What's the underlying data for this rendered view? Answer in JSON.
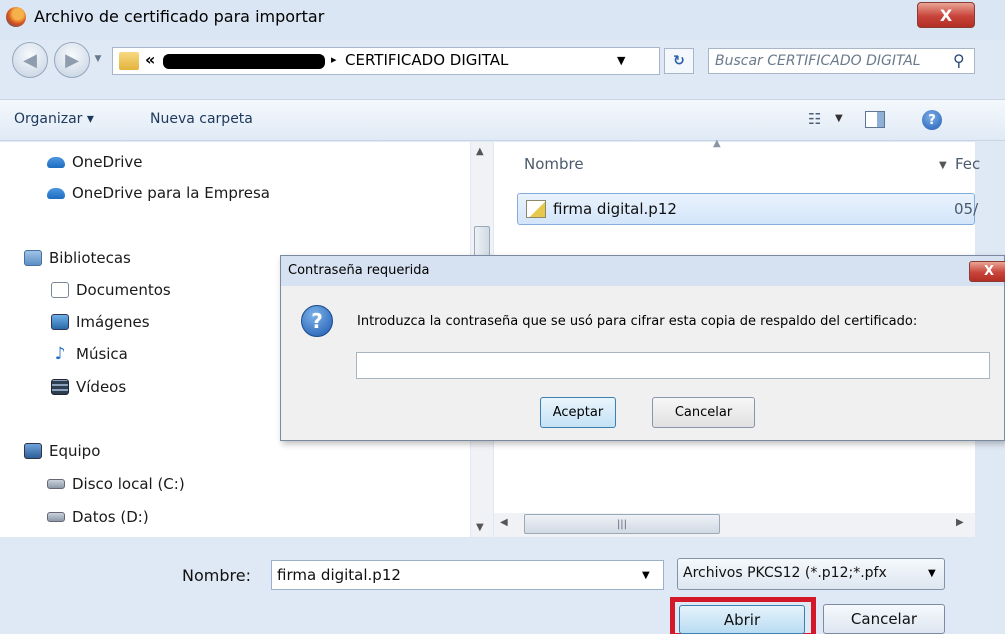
{
  "window": {
    "title": "Archivo de certificado para importar",
    "close_label": "X",
    "accent": "#dfe9f5"
  },
  "address": {
    "chevron": "«",
    "separator": "▸",
    "path": "CERTIFICADO DIGITAL",
    "search_placeholder": "Buscar CERTIFICADO DIGITAL"
  },
  "toolbar": {
    "organize_label": "Organizar ▾",
    "new_folder_label": "Nueva carpeta"
  },
  "sidebar": {
    "items": [
      {
        "label": "OneDrive",
        "icon": "cloud-icon"
      },
      {
        "label": "OneDrive para la Empresa",
        "icon": "cloud-icon"
      },
      {
        "label": "Bibliotecas",
        "icon": "library-icon"
      },
      {
        "label": "Documentos",
        "icon": "document-icon"
      },
      {
        "label": "Imágenes",
        "icon": "pictures-icon"
      },
      {
        "label": "Música",
        "icon": "music-icon"
      },
      {
        "label": "Vídeos",
        "icon": "video-icon"
      },
      {
        "label": "Equipo",
        "icon": "computer-icon"
      },
      {
        "label": "Disco local (C:)",
        "icon": "drive-icon"
      },
      {
        "label": "Datos (D:)",
        "icon": "drive-icon"
      }
    ]
  },
  "file_list": {
    "columns": [
      "Nombre",
      "Fec"
    ],
    "rows": [
      {
        "name": "firma digital.p12",
        "date": "05/"
      }
    ]
  },
  "footer": {
    "filename_label": "Nombre:",
    "filename_value": "firma digital.p12",
    "filter_value": "Archivos PKCS12 (*.p12;*.pfx",
    "open_label": "Abrir",
    "cancel_label": "Cancelar",
    "highlight_color": "#d3182a"
  },
  "dialog": {
    "title": "Contraseña requerida",
    "close_label": "X",
    "prompt": "Introduzca la contraseña que se usó para cifrar esta copia de respaldo del certificado:",
    "password_value": "",
    "ok_label": "Aceptar",
    "cancel_label": "Cancelar"
  }
}
